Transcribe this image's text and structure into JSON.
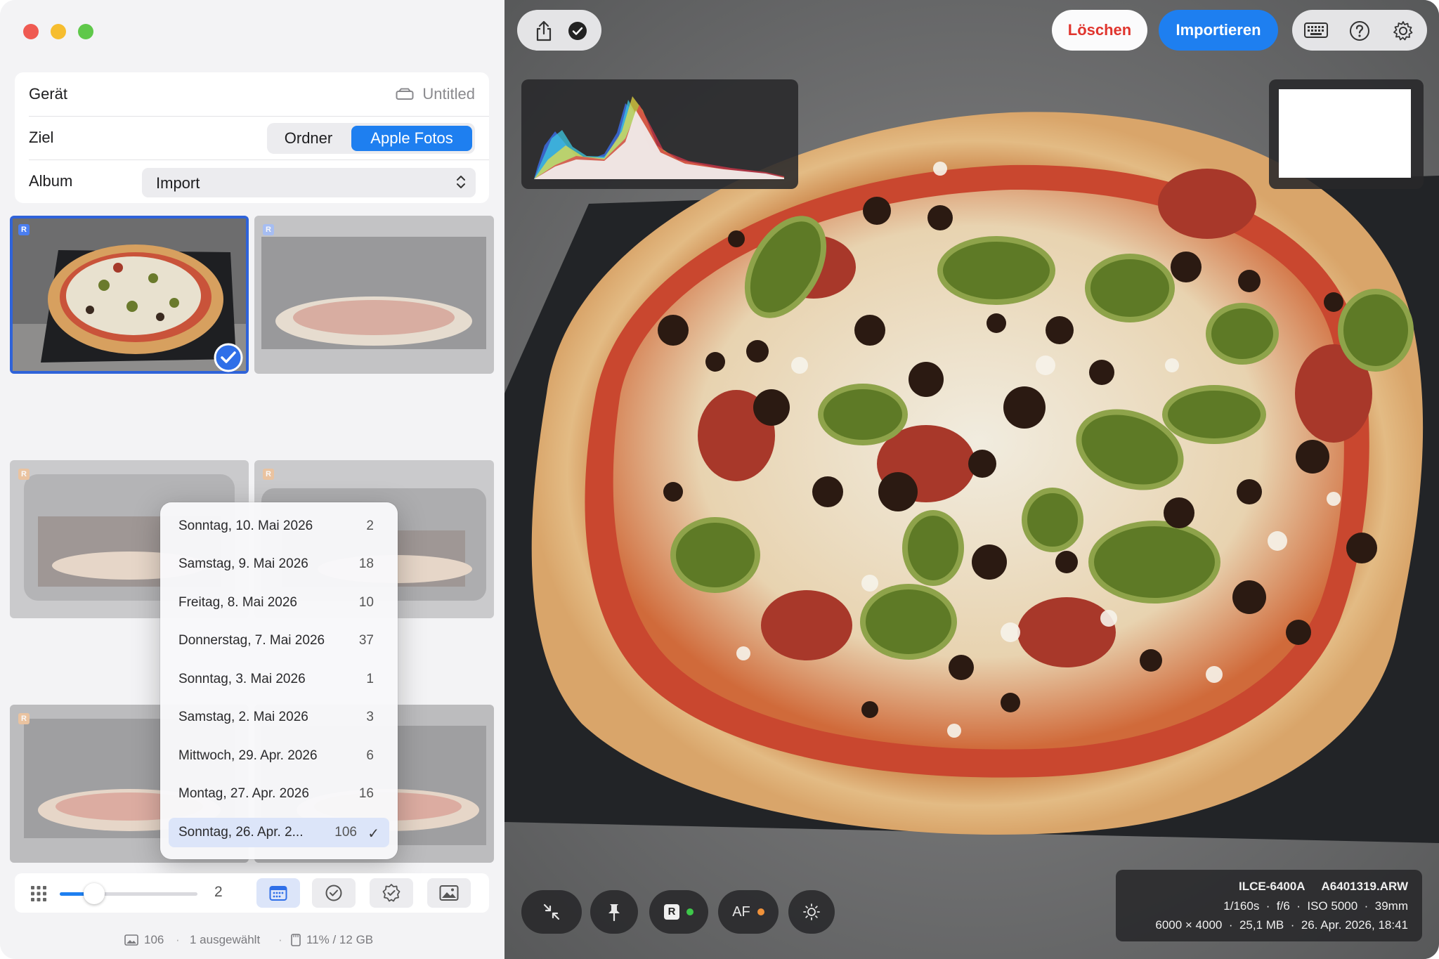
{
  "sidebar": {
    "device_label": "Gerät",
    "device_value": "Untitled",
    "target_label": "Ziel",
    "target_options": [
      "Ordner",
      "Apple Fotos"
    ],
    "target_selected": "Apple Fotos",
    "album_label": "Album",
    "album_value": "Import",
    "thumb_badge": "R"
  },
  "date_menu": {
    "items": [
      {
        "date": "Sonntag, 10. Mai 2026",
        "count": "2"
      },
      {
        "date": "Samstag, 9. Mai 2026",
        "count": "18"
      },
      {
        "date": "Freitag, 8. Mai 2026",
        "count": "10"
      },
      {
        "date": "Donnerstag, 7. Mai 2026",
        "count": "37"
      },
      {
        "date": "Sonntag, 3. Mai 2026",
        "count": "1"
      },
      {
        "date": "Samstag, 2. Mai 2026",
        "count": "3"
      },
      {
        "date": "Mittwoch, 29. Apr. 2026",
        "count": "6"
      },
      {
        "date": "Montag, 27. Apr. 2026",
        "count": "16"
      },
      {
        "date": "Sonntag, 26. Apr. 2...",
        "count": "106",
        "selected": true
      }
    ]
  },
  "bottom_bar": {
    "slider_value": "2",
    "slider_fraction": 0.17
  },
  "status": {
    "photos": "106",
    "selected": "1 ausgewählt",
    "storage": "11% / 12 GB"
  },
  "toolbar": {
    "delete_label": "Löschen",
    "import_label": "Importieren"
  },
  "bottom_tools": {
    "raw_badge": "R",
    "af_label": "AF"
  },
  "info": {
    "camera": "ILCE-6400A",
    "filename": "A6401319.ARW",
    "exposure": "1/160s",
    "aperture": "f/6",
    "iso": "ISO 5000",
    "focal": "39mm",
    "dimensions": "6000 × 4000",
    "size": "25,1 MB",
    "date": "26. Apr. 2026, 18:41"
  },
  "colors": {
    "accent": "#1e7ff0",
    "delete": "#e0352e",
    "green_dot": "#3ec84a",
    "orange_dot": "#f0923a"
  },
  "icons": [
    "share-icon",
    "check-circle-icon",
    "keyboard-icon",
    "help-icon",
    "settings-icon",
    "collapse-icon",
    "pin-icon",
    "sun-icon",
    "grid-icon",
    "calendar-icon",
    "badge-check-icon",
    "image-icon",
    "disk-icon"
  ]
}
